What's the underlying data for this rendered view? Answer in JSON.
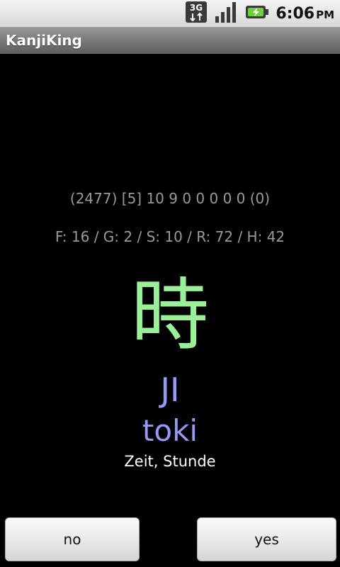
{
  "status_bar": {
    "network_label": "3G",
    "time": "6:06",
    "ampm": "PM",
    "icons": [
      "network-3g-icon",
      "signal-strength-icon",
      "battery-charging-icon"
    ]
  },
  "app": {
    "title": "KanjiKing"
  },
  "card": {
    "stats_line_1": "(2477) [5] 10 9 0 0 0 0 0 (0)",
    "stats_line_2": "F: 16 / G: 2 / S: 10 / R: 72 / H: 42",
    "kanji": "時",
    "onyomi": "JI",
    "kunyomi": "toki",
    "meaning": "Zeit, Stunde"
  },
  "buttons": {
    "no_label": "no",
    "yes_label": "yes"
  },
  "colors": {
    "kanji": "#99f099",
    "reading": "#9999f5",
    "stats": "#9a9a9a",
    "meaning": "#ffffff"
  }
}
